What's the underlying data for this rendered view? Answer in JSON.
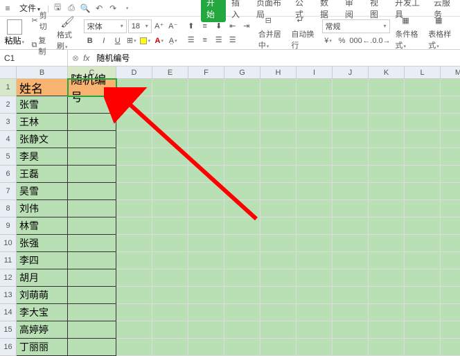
{
  "titlebar": {
    "file_label": "文件"
  },
  "ribbon": {
    "tabs": [
      "开始",
      "插入",
      "页面布局",
      "公式",
      "数据",
      "审阅",
      "视图",
      "开发工具",
      "云服务"
    ],
    "active_tab": "开始",
    "paste": "粘贴",
    "cut": "剪切",
    "copy": "复制",
    "format_painter": "格式刷",
    "font_name": "宋体",
    "font_size": "18",
    "merge_center": "合并居中",
    "auto_wrap": "自动换行",
    "number_format": "常规",
    "cond_format": "条件格式",
    "table_style": "表格样式"
  },
  "namebar": {
    "cell_ref": "C1",
    "fx": "fx",
    "formula": "随机编号"
  },
  "columns": [
    "B",
    "C",
    "D",
    "E",
    "F",
    "G",
    "H",
    "I",
    "J",
    "K",
    "L",
    "M"
  ],
  "rows": [
    {
      "n": "1",
      "b": "姓名",
      "c": "随机编号",
      "head": true
    },
    {
      "n": "2",
      "b": "张雪",
      "c": ""
    },
    {
      "n": "3",
      "b": "王林",
      "c": ""
    },
    {
      "n": "4",
      "b": "张静文",
      "c": ""
    },
    {
      "n": "5",
      "b": "李昊",
      "c": ""
    },
    {
      "n": "6",
      "b": "王磊",
      "c": ""
    },
    {
      "n": "7",
      "b": "吴雪",
      "c": ""
    },
    {
      "n": "8",
      "b": "刘伟",
      "c": ""
    },
    {
      "n": "9",
      "b": "林雪",
      "c": ""
    },
    {
      "n": "10",
      "b": "张强",
      "c": ""
    },
    {
      "n": "11",
      "b": "李四",
      "c": ""
    },
    {
      "n": "12",
      "b": "胡月",
      "c": ""
    },
    {
      "n": "13",
      "b": "刘萌萌",
      "c": ""
    },
    {
      "n": "14",
      "b": "李大宝",
      "c": ""
    },
    {
      "n": "15",
      "b": "高婷婷",
      "c": ""
    },
    {
      "n": "16",
      "b": "丁丽丽",
      "c": ""
    }
  ]
}
